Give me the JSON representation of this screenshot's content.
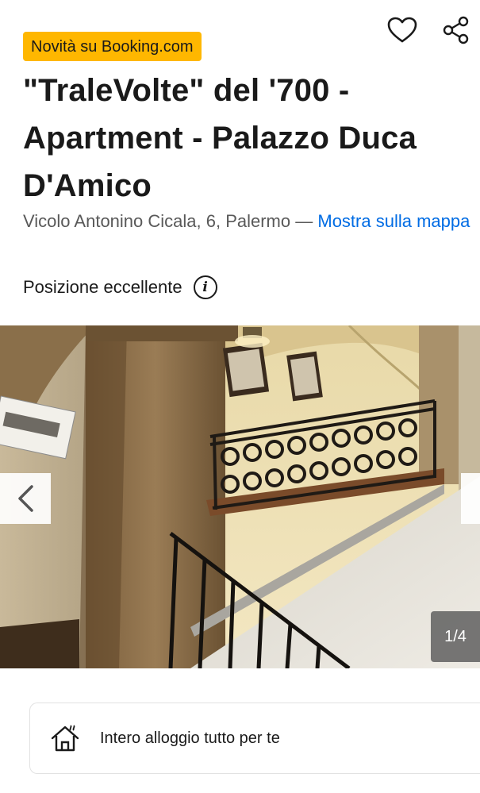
{
  "header": {
    "favorite_icon": "heart-outline-icon",
    "share_icon": "share-nodes-icon"
  },
  "badge": {
    "label": "Novità su Booking.com",
    "color": "#ffb700"
  },
  "property": {
    "title": "\"TraleVolte\" del '700 - Apartment - Palazzo Duca D'Amico",
    "address": "Vicolo Antonino Cicala, 6, Palermo",
    "separator": "—",
    "map_link": "Mostra sulla mappa",
    "location_rating": "Posizione eccellente"
  },
  "gallery": {
    "counter": "1/4",
    "prev_icon": "chevron-left-icon",
    "next_icon": "chevron-right-icon"
  },
  "features": [
    {
      "icon": "house-icon",
      "label": "Intero alloggio tutto per te"
    }
  ],
  "colors": {
    "link": "#006ce4",
    "text": "#1a1a1a",
    "muted": "#595959"
  }
}
